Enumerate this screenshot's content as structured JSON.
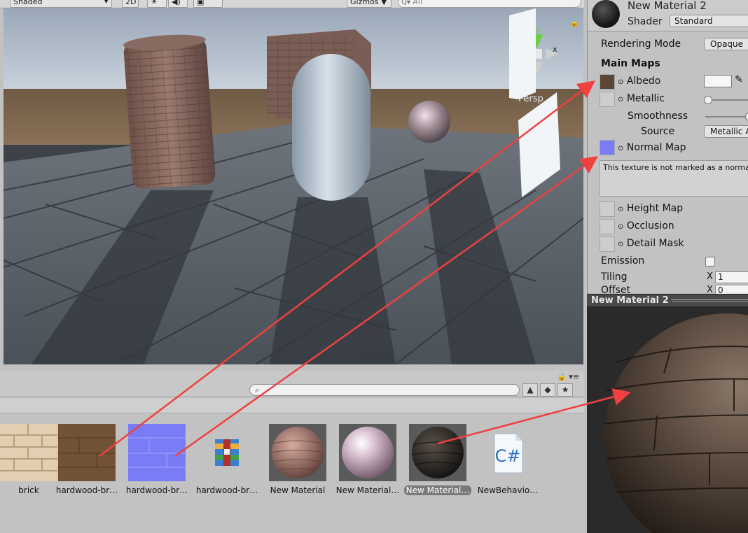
{
  "scene": {
    "shading_mode": "Shaded",
    "mode_2d": "2D",
    "gizmos": "Gizmos",
    "search_placeholder": "All",
    "projection": "Persp",
    "gizmo_axes": {
      "y": "y",
      "x": "x"
    }
  },
  "project": {
    "assets": [
      {
        "label": "brick",
        "kind": "texture-brick"
      },
      {
        "label": "hardwood-br…",
        "kind": "texture-wood"
      },
      {
        "label": "hardwood-br…",
        "kind": "texture-normal"
      },
      {
        "label": "hardwood-br…",
        "kind": "archive"
      },
      {
        "label": "New Material",
        "kind": "material-brick"
      },
      {
        "label": "New Material…",
        "kind": "material-pink"
      },
      {
        "label": "New Material…",
        "kind": "material-dark",
        "selected": true
      },
      {
        "label": "NewBehavio…",
        "kind": "script-csharp"
      }
    ],
    "script_icon_text": "C#"
  },
  "inspector": {
    "material_name": "New Material 2",
    "shader_label": "Shader",
    "shader_value": "Standard",
    "rendering_mode_label": "Rendering Mode",
    "rendering_mode_value": "Opaque",
    "main_maps_label": "Main Maps",
    "albedo_label": "Albedo",
    "metallic_label": "Metallic",
    "smoothness_label": "Smoothness",
    "source_label": "Source",
    "source_value": "Metallic Alpha",
    "normal_map_label": "Normal Map",
    "normal_warning": "This texture is not marked as a normal map",
    "height_map_label": "Height Map",
    "occlusion_label": "Occlusion",
    "detail_mask_label": "Detail Mask",
    "emission_label": "Emission",
    "tiling_label": "Tiling",
    "tiling_x_axis": "X",
    "tiling_x_value": "1",
    "offset_label": "Offset",
    "offset_x_axis": "X",
    "offset_x_value": "0",
    "albedo_color": "#5c4636",
    "normal_color": "#7b7bf5"
  },
  "preview": {
    "title": "New Material 2"
  },
  "colors": {
    "annotation_arrow": "#f04040"
  }
}
